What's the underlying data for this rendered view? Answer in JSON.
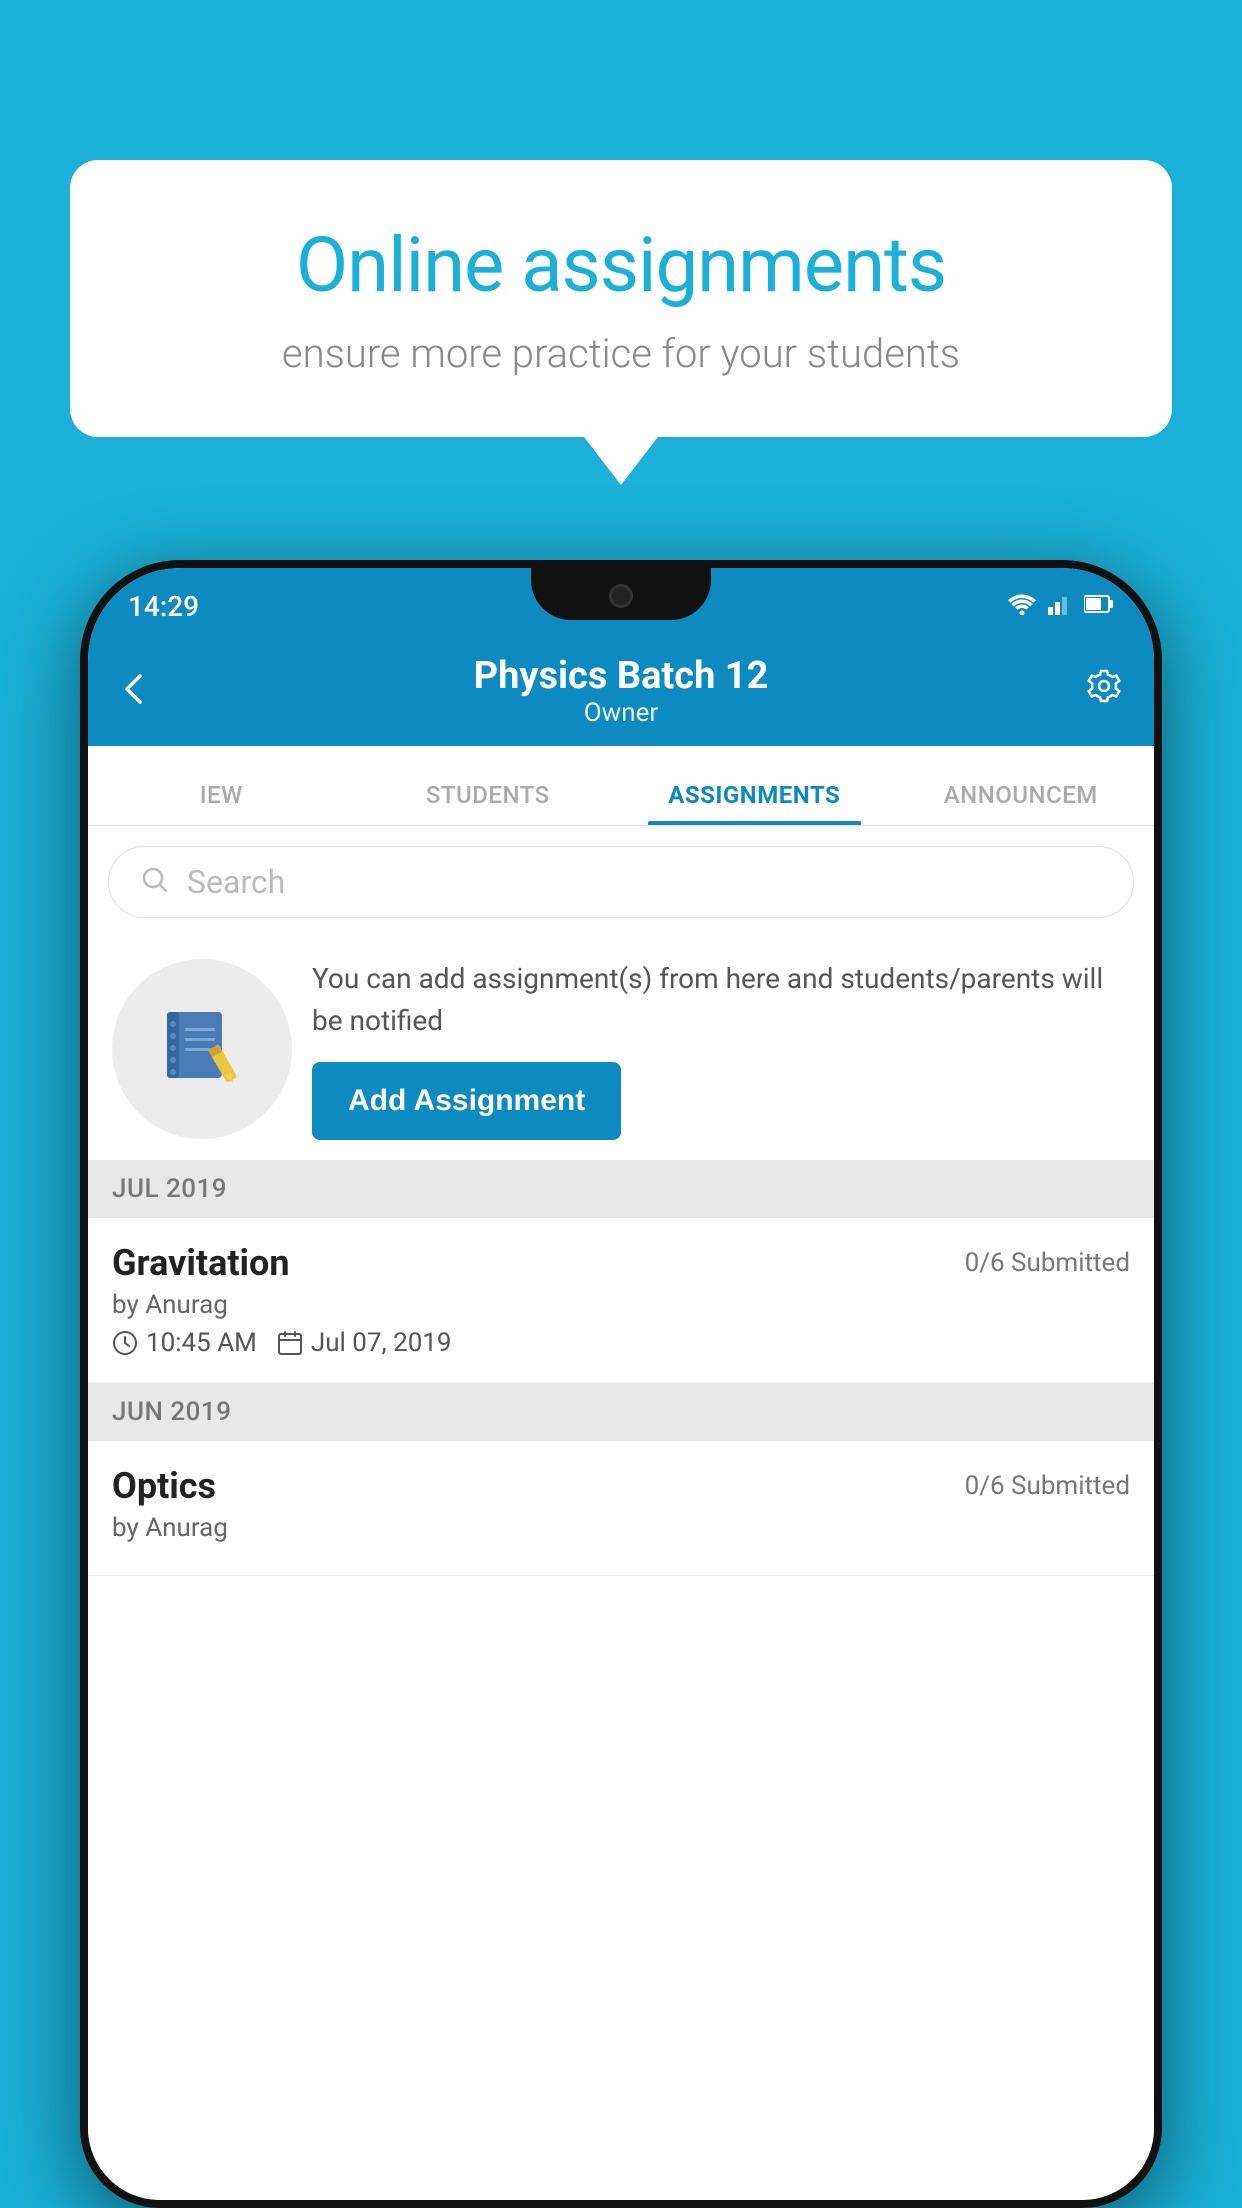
{
  "background": {
    "color": "#1ab0d8"
  },
  "speech_bubble": {
    "title": "Online assignments",
    "subtitle": "ensure more practice for your students"
  },
  "status_bar": {
    "time": "14:29",
    "icons": [
      "wifi",
      "signal",
      "battery"
    ]
  },
  "app_header": {
    "title": "Physics Batch 12",
    "subtitle": "Owner",
    "back_label": "←",
    "settings_label": "⚙"
  },
  "tabs": [
    {
      "label": "IEW",
      "active": false
    },
    {
      "label": "STUDENTS",
      "active": false
    },
    {
      "label": "ASSIGNMENTS",
      "active": true
    },
    {
      "label": "ANNOUNCEM",
      "active": false
    }
  ],
  "search": {
    "placeholder": "Search"
  },
  "promo": {
    "description": "You can add assignment(s) from here and students/parents will be notified",
    "add_button_label": "Add Assignment"
  },
  "month_groups": [
    {
      "month": "JUL 2019",
      "assignments": [
        {
          "name": "Gravitation",
          "submitted": "0/6 Submitted",
          "by": "by Anurag",
          "time": "10:45 AM",
          "date": "Jul 07, 2019"
        }
      ]
    },
    {
      "month": "JUN 2019",
      "assignments": [
        {
          "name": "Optics",
          "submitted": "0/6 Submitted",
          "by": "by Anurag",
          "time": "",
          "date": ""
        }
      ]
    }
  ]
}
